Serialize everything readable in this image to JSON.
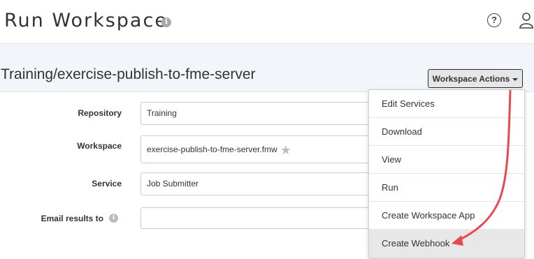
{
  "header": {
    "title": "Run Workspace",
    "info_icon": "info-icon",
    "help_icon": "question-circle-icon",
    "user_icon": "user-icon"
  },
  "workspace": {
    "path": "Training/exercise-publish-to-fme-server",
    "actions_button_label": "Workspace Actions"
  },
  "form": {
    "repository": {
      "label": "Repository",
      "value": "Training"
    },
    "workspace": {
      "label": "Workspace",
      "value": "exercise-publish-to-fme-server.fmw",
      "favorite_icon": "star-icon"
    },
    "service": {
      "label": "Service",
      "value": "Job Submitter"
    },
    "email": {
      "label": "Email results to",
      "value": "",
      "info_icon": "info-icon"
    }
  },
  "dropdown": {
    "items": [
      {
        "label": "Edit Services"
      },
      {
        "label": "Download"
      },
      {
        "label": "View"
      },
      {
        "label": "Run"
      },
      {
        "label": "Create Workspace App"
      },
      {
        "label": "Create Webhook"
      }
    ]
  },
  "colors": {
    "annotation_arrow": "#e8484f",
    "content_bg": "#f2f5f9"
  }
}
